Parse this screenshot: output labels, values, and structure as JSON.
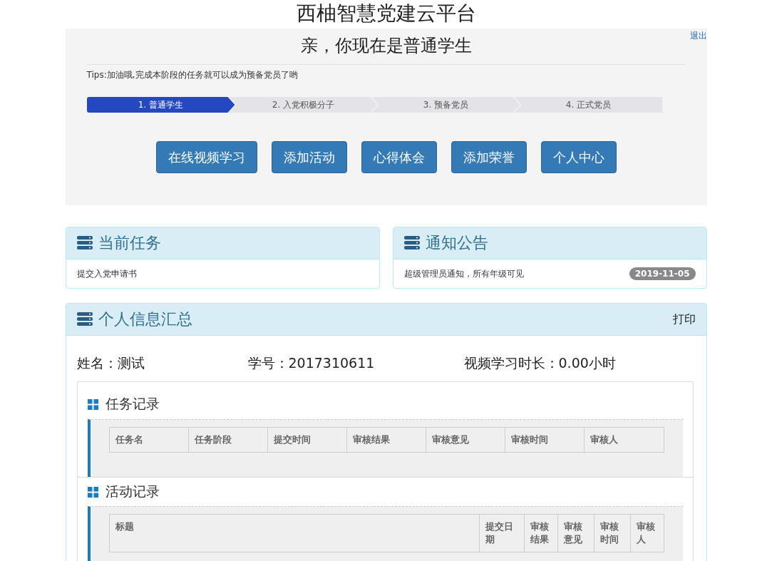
{
  "site_title": "西柚智慧党建云平台",
  "logout": "退出",
  "hero": {
    "title": "亲，你现在是普通学生",
    "tips": "Tips:加油哦,完成本阶段的任务就可以成为预备党员了哟"
  },
  "steps": [
    {
      "label": "1. 普通学生",
      "selected": true
    },
    {
      "label": "2. 入党积极分子",
      "selected": false
    },
    {
      "label": "3. 预备党员",
      "selected": false
    },
    {
      "label": "4. 正式党员",
      "selected": false
    }
  ],
  "buttons": [
    "在线视频学习",
    "添加活动",
    "心得体会",
    "添加荣誉",
    "个人中心"
  ],
  "current_task": {
    "title": "当前任务",
    "text": "提交入党申请书"
  },
  "notice": {
    "title": "通知公告",
    "text": "超级管理员通知，所有年级可见",
    "date": "2019-11-05"
  },
  "summary": {
    "title": "个人信息汇总",
    "print": "打印",
    "name": "姓名：测试",
    "student_id": "学号：2017310611",
    "video_time": "视频学习时长：0.00小时",
    "sections": [
      {
        "title": "任务记录",
        "columns": [
          "任务名",
          "任务阶段",
          "提交时间",
          "审核结果",
          "审核意见",
          "审核时间",
          "审核人"
        ]
      },
      {
        "title": "活动记录",
        "columns": [
          "标题",
          "提交日期",
          "审核结果",
          "审核意见",
          "审核时间",
          "审核人"
        ]
      }
    ]
  }
}
